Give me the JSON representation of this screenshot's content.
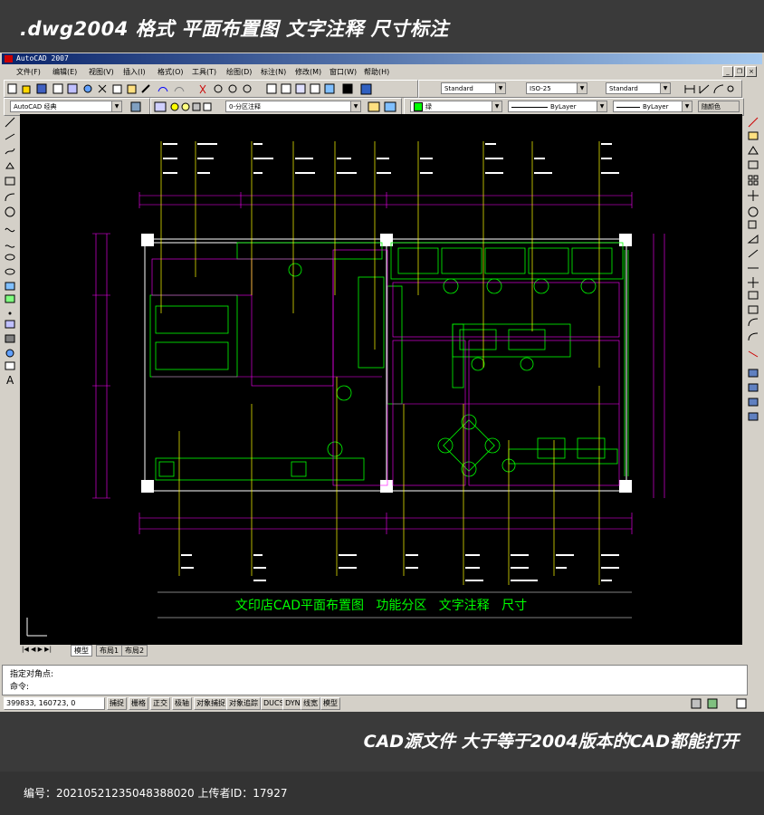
{
  "banner_top": ".dwg2004 格式  平面布置图 文字注释 尺寸标注",
  "window": {
    "title": "AutoCAD 2007"
  },
  "menu": [
    "文件(F)",
    "编辑(E)",
    "视图(V)",
    "插入(I)",
    "格式(O)",
    "工具(T)",
    "绘图(D)",
    "标注(N)",
    "修改(M)",
    "窗口(W)",
    "帮助(H)"
  ],
  "toolbar": {
    "text_style": "Standard",
    "dim_style": "ISO-25",
    "table_style": "Standard",
    "workspace": "AutoCAD 经典",
    "layer": "0-分区注释",
    "color": "绿",
    "linetype": "ByLayer",
    "lineweight": "ByLayer",
    "plotstyle": "随颜色"
  },
  "drawing": {
    "title": "文印店CAD平面布置图   功能分区   文字注释   尺寸",
    "colors": {
      "background": "#000000",
      "wall": "#ffffff",
      "furniture": "#00ff00",
      "annotation": "#ffff00",
      "dimension": "#ff00ff"
    }
  },
  "tabs": [
    "模型",
    "布局1",
    "布局2"
  ],
  "command": {
    "line1": "指定对角点:",
    "line2": "命令:"
  },
  "status": {
    "coords": "399833, 160723, 0",
    "buttons": [
      "捕捉",
      "栅格",
      "正交",
      "极轴",
      "对象捕捉",
      "对象追踪",
      "DUCS",
      "DYN",
      "线宽",
      "模型"
    ]
  },
  "banner_bottom": "CAD源文件  大于等于2004版本的CAD都能打开",
  "footer": "编号：20210521235048388020 上传者ID：17927"
}
